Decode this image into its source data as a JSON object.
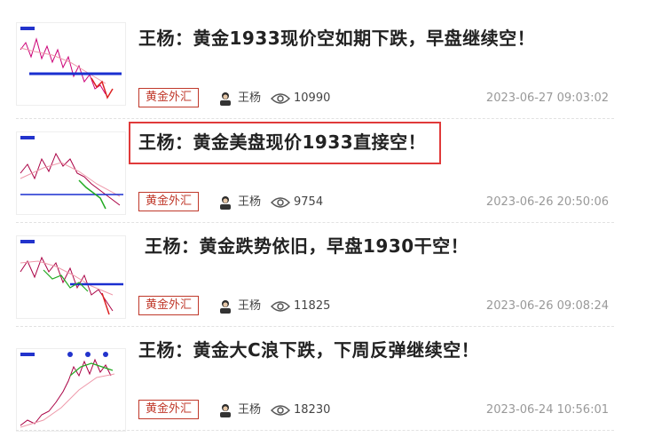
{
  "articles": [
    {
      "title": "王杨：黄金1933现价空如期下跌，早盘继续空！",
      "category": "黄金外汇",
      "author": "王杨",
      "views": "10990",
      "date": "2023-06-27 09:03:02"
    },
    {
      "title": "王杨：黄金美盘现价1933直接空！",
      "category": "黄金外汇",
      "author": "王杨",
      "views": "9754",
      "date": "2023-06-26 20:50:06"
    },
    {
      "title": "王杨：黄金跌势依旧，早盘1930干空！",
      "category": "黄金外汇",
      "author": "王杨",
      "views": "11825",
      "date": "2023-06-26 09:08:24"
    },
    {
      "title": "王杨：黄金大C浪下跌，下周反弹继续空！",
      "category": "黄金外汇",
      "author": "王杨",
      "views": "18230",
      "date": "2023-06-24 10:56:01"
    }
  ],
  "colors": {
    "tag": "#c0392b",
    "highlight_box": "#e03a3a",
    "date": "#999999"
  },
  "icons": {
    "views": "eye-icon",
    "author": "avatar"
  }
}
